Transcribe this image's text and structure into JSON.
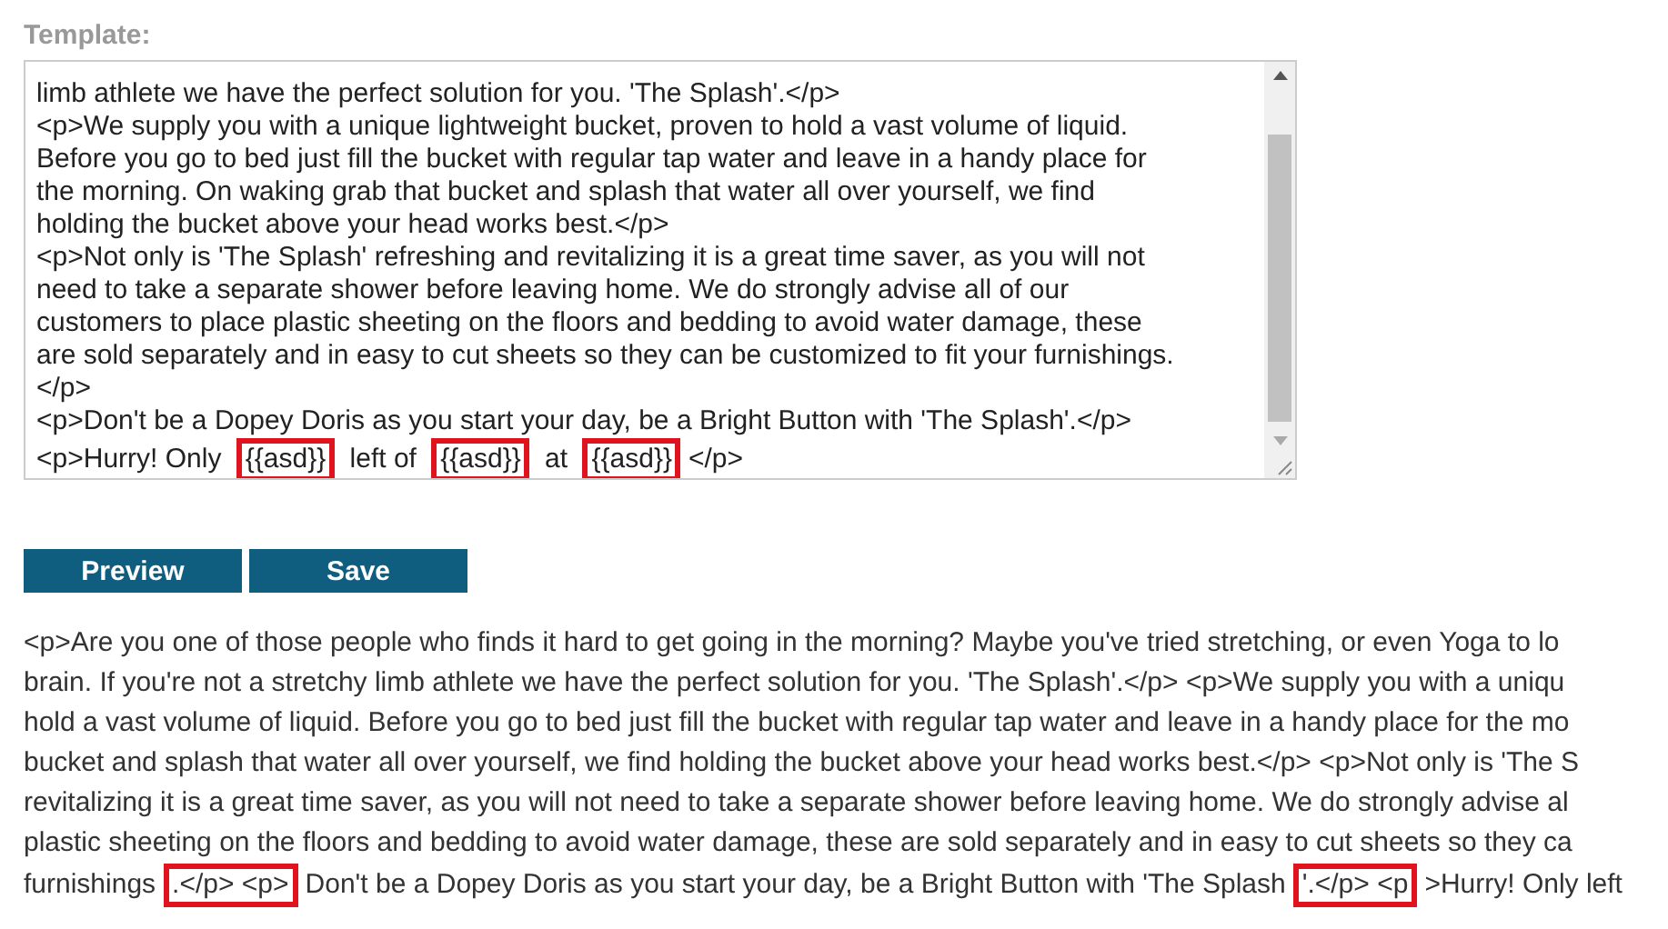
{
  "template_label": "Template:",
  "template_lines": [
    {
      "segments": [
        {
          "text": "limb athlete we have the perfect solution for you. 'The Splash'.</p>",
          "highlighted": false
        }
      ]
    },
    {
      "segments": [
        {
          "text": "<p>We supply you with a unique lightweight bucket, proven to hold a vast volume of liquid.",
          "highlighted": false
        }
      ]
    },
    {
      "segments": [
        {
          "text": "Before you go to bed just fill the bucket with regular tap water and leave in a handy place for",
          "highlighted": false
        }
      ]
    },
    {
      "segments": [
        {
          "text": "the morning. On waking grab that bucket and splash that water all over yourself, we find",
          "highlighted": false
        }
      ]
    },
    {
      "segments": [
        {
          "text": "holding the bucket above your head works best.</p>",
          "highlighted": false
        }
      ]
    },
    {
      "segments": [
        {
          "text": "<p>Not only is 'The Splash' refreshing and revitalizing it is a great time saver, as you will not",
          "highlighted": false
        }
      ]
    },
    {
      "segments": [
        {
          "text": "need to take a separate shower before leaving home. We do strongly advise all of our",
          "highlighted": false
        }
      ]
    },
    {
      "segments": [
        {
          "text": "customers to place plastic sheeting on the floors and bedding to avoid water damage, these",
          "highlighted": false
        }
      ]
    },
    {
      "segments": [
        {
          "text": "are sold separately and in easy to cut sheets so they can be customized to fit your furnishings.",
          "highlighted": false
        }
      ]
    },
    {
      "segments": [
        {
          "text": "</p>",
          "highlighted": false
        }
      ]
    },
    {
      "segments": [
        {
          "text": "<p>Don't be a Dopey Doris as you start your day, be a Bright Button with 'The Splash'.</p>",
          "highlighted": false
        }
      ]
    },
    {
      "segments": [
        {
          "text": "<p>Hurry! Only ",
          "highlighted": false
        },
        {
          "text": "{{asd}}",
          "highlighted": true
        },
        {
          "text": " left of ",
          "highlighted": false
        },
        {
          "text": "{{asd}}",
          "highlighted": true
        },
        {
          "text": " at ",
          "highlighted": false
        },
        {
          "text": "{{asd}}",
          "highlighted": true
        },
        {
          "text": "</p>",
          "highlighted": false
        }
      ]
    }
  ],
  "buttons": [
    {
      "label": "Preview"
    },
    {
      "label": "Save"
    }
  ],
  "preview_lines": [
    {
      "segments": [
        {
          "text": "<p>Are you one of those people who finds it hard to get going in the morning? Maybe you've tried stretching, or even Yoga to lo",
          "highlighted": false
        }
      ]
    },
    {
      "segments": [
        {
          "text": "brain. If you're not a stretchy limb athlete we have the perfect solution for you. 'The Splash'.</p> <p>We supply you with a uniqu",
          "highlighted": false
        }
      ]
    },
    {
      "segments": [
        {
          "text": "hold a vast volume of liquid. Before you go to bed just fill the bucket with regular tap water and leave in a handy place for the mo",
          "highlighted": false
        }
      ]
    },
    {
      "segments": [
        {
          "text": "bucket and splash that water all over yourself, we find holding the bucket above your head works best.</p> <p>Not only is 'The S",
          "highlighted": false
        }
      ]
    },
    {
      "segments": [
        {
          "text": "revitalizing it is a great time saver, as you will not need to take a separate shower before leaving home. We do strongly advise al",
          "highlighted": false
        }
      ]
    },
    {
      "segments": [
        {
          "text": "plastic sheeting on the floors and bedding to avoid water damage, these are sold separately and in easy to cut sheets so they ca",
          "highlighted": false
        }
      ]
    },
    {
      "segments": [
        {
          "text": "furnishings",
          "highlighted": false
        },
        {
          "text": ".</p> <p>",
          "highlighted": true
        },
        {
          "text": "Don't be a Dopey Doris as you start your day, be a Bright Button with 'The Splash",
          "highlighted": false
        },
        {
          "text": "'.</p> <p",
          "highlighted": true
        },
        {
          "text": ">Hurry! Only left",
          "highlighted": false
        }
      ]
    }
  ]
}
